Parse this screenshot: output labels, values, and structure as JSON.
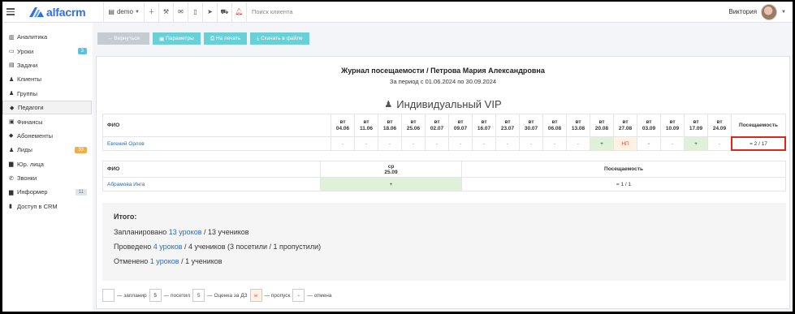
{
  "app": {
    "logo_text": "alfacrm",
    "brand_color": "#2f6ee6"
  },
  "topbar": {
    "branch": "demo",
    "search_placeholder": "Поиск клиента",
    "user_name": "Виктория",
    "icons": [
      "plus-icon",
      "wrench-icon",
      "mail-icon",
      "phone-icon",
      "telegram-icon",
      "cart-icon",
      "bell-icon"
    ]
  },
  "sidebar": {
    "items": [
      {
        "label": "Аналитика",
        "icon": "chart-icon"
      },
      {
        "label": "Уроки",
        "icon": "calendar-icon",
        "badge": "3",
        "badge_style": "blue"
      },
      {
        "label": "Задачи",
        "icon": "tasks-icon"
      },
      {
        "label": "Клиенты",
        "icon": "user-icon"
      },
      {
        "label": "Группы",
        "icon": "users-icon"
      },
      {
        "label": "Педагоги",
        "icon": "graduation-cap-icon",
        "active": true
      },
      {
        "label": "Финансы",
        "icon": "money-icon"
      },
      {
        "label": "Абонементы",
        "icon": "tag-icon"
      },
      {
        "label": "Лиды",
        "icon": "user-plus-icon",
        "badge": "33",
        "badge_style": "orange"
      },
      {
        "label": "Юр. лица",
        "icon": "briefcase-icon"
      },
      {
        "label": "Звонки",
        "icon": "phone-icon"
      },
      {
        "label": "Информер",
        "icon": "briefcase-icon",
        "badge": "11",
        "badge_style": "grey"
      },
      {
        "label": "Доступ в CRM",
        "icon": "lock-icon"
      }
    ]
  },
  "toolbar": {
    "back_label": "← Вернуться",
    "params_label": "Параметры",
    "print_label": "На печать",
    "download_label": "Скачать в файле"
  },
  "journal": {
    "title": "Журнал посещаемости / Петрова Мария Александровна",
    "period": "За период с 01.06.2024 по 30.09.2024",
    "group_title": "Индивидуальный VIP"
  },
  "table1": {
    "fio_header": "ФИО",
    "attendance_header": "Посещаемость",
    "dates": [
      {
        "day": "вт",
        "date": "04.06"
      },
      {
        "day": "вт",
        "date": "11.06"
      },
      {
        "day": "вт",
        "date": "18.06"
      },
      {
        "day": "вт",
        "date": "25.06"
      },
      {
        "day": "вт",
        "date": "02.07"
      },
      {
        "day": "вт",
        "date": "09.07"
      },
      {
        "day": "вт",
        "date": "16.07"
      },
      {
        "day": "вт",
        "date": "23.07"
      },
      {
        "day": "вт",
        "date": "30.07"
      },
      {
        "day": "вт",
        "date": "06.08"
      },
      {
        "day": "вт",
        "date": "13.08"
      },
      {
        "day": "вт",
        "date": "20.08"
      },
      {
        "day": "вт",
        "date": "27.08"
      },
      {
        "day": "вт",
        "date": "03.09"
      },
      {
        "day": "вт",
        "date": "10.09"
      },
      {
        "day": "вт",
        "date": "17.09"
      },
      {
        "day": "вт",
        "date": "24.09"
      }
    ],
    "rows": [
      {
        "name": "Евгений Орлов",
        "cells": [
          "-",
          "-",
          "-",
          "-",
          "-",
          "-",
          "-",
          "-",
          "-",
          "-",
          "-",
          "+",
          "НП",
          "-",
          "-",
          "+",
          "-"
        ],
        "cell_styles": [
          "",
          "",
          "",
          "",
          "",
          "",
          "",
          "",
          "",
          "",
          "",
          "green",
          "np",
          "red",
          "",
          "green",
          ""
        ],
        "attendance": "= 2 / 17"
      }
    ]
  },
  "table2": {
    "fio_header": "ФИО",
    "date_day": "ср",
    "date": "25.09",
    "attendance_header": "Посещаемость",
    "rows": [
      {
        "name": "Абрамова Инга",
        "mark": "+",
        "attendance": "= 1 / 1"
      }
    ]
  },
  "totals": {
    "heading": "Итого:",
    "planned_prefix": "Запланировано",
    "planned_link": "13 уроков",
    "planned_suffix": "/ 13 учеников",
    "done_prefix": "Проведено",
    "done_link": "4 уроков",
    "done_suffix": "/ 4 учеников (3 посетили / 1 пропустили)",
    "cancelled_prefix": "Отменено",
    "cancelled_link": "1 уроков",
    "cancelled_suffix": "/ 1 учеников"
  },
  "legend": {
    "planned": "— запланир",
    "visited_box": "5",
    "visited": "— посетил",
    "grade_box": "5",
    "grade": "— Оценка за ДЗ",
    "skip_box": "н",
    "skip": "— пропуск",
    "cancel_box": "-",
    "cancel": "— отмена"
  }
}
